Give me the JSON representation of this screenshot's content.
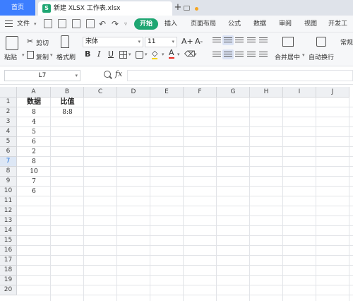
{
  "tabs": {
    "home": "首页",
    "document": "新建 XLSX 工作表.xlsx",
    "add": "+"
  },
  "menu": {
    "file": "文件",
    "items": [
      "开始",
      "插入",
      "页面布局",
      "公式",
      "数据",
      "审阅",
      "视图",
      "开发工具"
    ],
    "active_index": 0
  },
  "ribbon": {
    "paste": "粘贴",
    "cut": "剪切",
    "copy": "复制",
    "format_painter": "格式刷",
    "font_name": "宋体",
    "font_size": "11",
    "merge_center": "合并居中",
    "wrap_text": "自动换行",
    "number_format": "常规",
    "bold": "B",
    "italic": "I",
    "underline": "U",
    "font_color_letter": "A",
    "grow_font": "A+",
    "shrink_font": "A-"
  },
  "formula_bar": {
    "cell_ref": "L7",
    "fx": "fx",
    "formula": ""
  },
  "sheet": {
    "columns": [
      "A",
      "B",
      "C",
      "D",
      "E",
      "F",
      "G",
      "H",
      "I",
      "J"
    ],
    "rows": [
      "1",
      "2",
      "3",
      "4",
      "5",
      "6",
      "7",
      "8",
      "9",
      "10",
      "11",
      "12",
      "13",
      "14",
      "15",
      "16",
      "17",
      "18",
      "19",
      "20"
    ],
    "selected_row": "7",
    "cells": {
      "A1": "数据",
      "B1": "比值",
      "A2": "8",
      "B2": "8:8",
      "A3": "4",
      "A4": "5",
      "A5": "6",
      "A6": "2",
      "A7": "8",
      "A8": "10",
      "A9": "7",
      "A10": "6"
    }
  },
  "colors": {
    "accent_green": "#1ea672",
    "home_tab_blue": "#3d7eff",
    "selected_header": "#1e6fd9"
  },
  "icons": [
    "hamburger-menu-icon",
    "pin-icon",
    "unsaved-dot-icon",
    "paste-icon",
    "scissors-icon",
    "copy-icon",
    "brush-icon",
    "zoom-icon",
    "fx-icon"
  ]
}
